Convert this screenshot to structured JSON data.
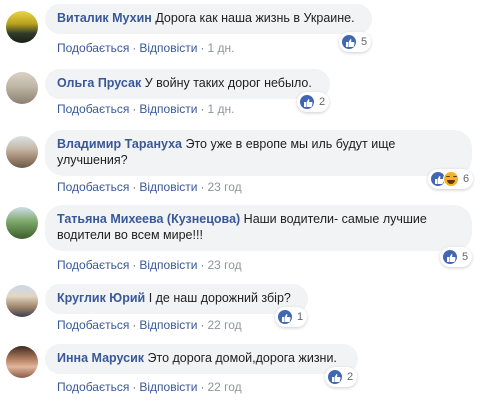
{
  "actions": {
    "like": "Подобається",
    "reply": "Відповісти"
  },
  "colors": {
    "author": "#385898",
    "bubble": "#f2f3f5",
    "like": "#4267b2",
    "haha": "#f7b125"
  },
  "comments": [
    {
      "author": "Виталик Мухин",
      "text": "Дорога как наша жизнь в Украине.",
      "time": "1 дн.",
      "reactions": [
        "like-icon"
      ],
      "count": "5"
    },
    {
      "author": "Ольга Прусак",
      "text": "У войну таких дорог небыло.",
      "time": "1 дн.",
      "reactions": [
        "like-icon"
      ],
      "count": "2"
    },
    {
      "author": "Владимир Тарануха",
      "text": "Это уже в европе мы иль будут ище улучшения?",
      "time": "23 год",
      "reactions": [
        "like-icon",
        "haha-icon"
      ],
      "count": "6"
    },
    {
      "author": "Татьяна Михеева (Кузнецова)",
      "text": "Наши водители- самые лучшие водители во всем мире!!!",
      "time": "23 год",
      "reactions": [
        "like-icon"
      ],
      "count": "5"
    },
    {
      "author": "Круглик Юрий",
      "text": "І де наш дорожний збір?",
      "time": "22 год",
      "reactions": [
        "like-icon"
      ],
      "count": "1"
    },
    {
      "author": "Инна Марусик",
      "text": "Это дорога домой,дорога жизни.",
      "time": "22 год",
      "reactions": [
        "like-icon"
      ],
      "count": "2"
    }
  ]
}
